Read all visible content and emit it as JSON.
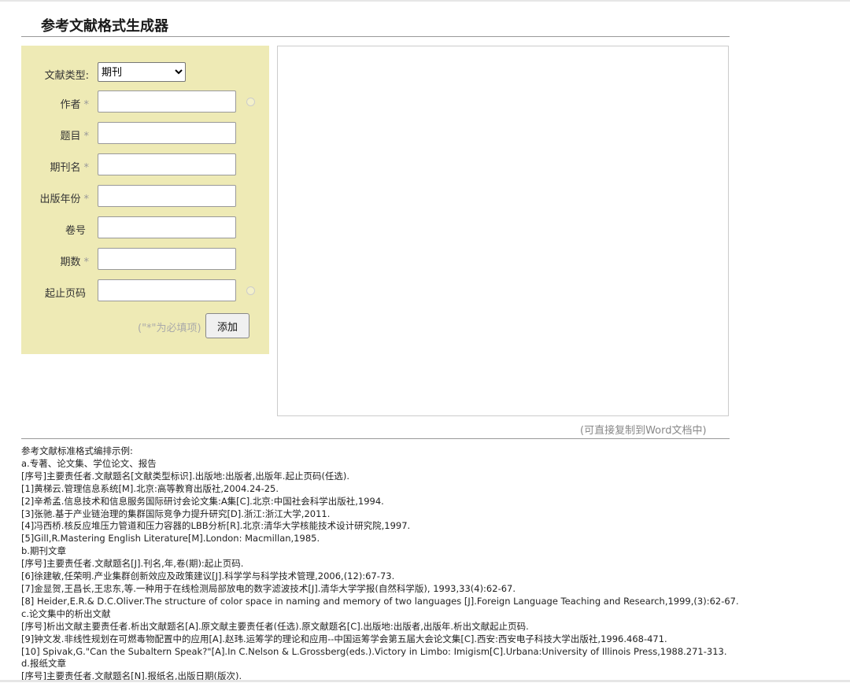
{
  "page": {
    "title": "参考文献格式生成器"
  },
  "form": {
    "doc_type_label": "文献类型:",
    "doc_type_value": "期刊",
    "fields": [
      {
        "label": "作者",
        "required": "*",
        "value": "",
        "optional_dot": true
      },
      {
        "label": "题目",
        "required": "*",
        "value": "",
        "optional_dot": false
      },
      {
        "label": "期刊名",
        "required": "*",
        "value": "",
        "optional_dot": false
      },
      {
        "label": "出版年份",
        "required": "*",
        "value": "",
        "optional_dot": false
      },
      {
        "label": "卷号",
        "required": "",
        "value": "",
        "optional_dot": false
      },
      {
        "label": "期数",
        "required": "*",
        "value": "",
        "optional_dot": false
      },
      {
        "label": "起止页码",
        "required": "",
        "value": "",
        "optional_dot": true
      }
    ],
    "required_hint": "(\"*\"为必填项)",
    "add_button": "添加"
  },
  "output": {
    "content": "",
    "copy_hint": "(可直接复制到Word文档中)"
  },
  "examples": [
    "参考文献标准格式编排示例:",
    "a.专著、论文集、学位论文、报告",
    "[序号]主要责任者.文献题名[文献类型标识].出版地:出版者,出版年.起止页码(任选).",
    "[1]黄梯云.管理信息系统[M].北京:高等教育出版社,2004.24-25.",
    "[2]辛希孟.信息技术和信息服务国际研讨会论文集:A集[C].北京:中国社会科学出版社,1994.",
    "[3]张驰.基于产业链治理的集群国际竞争力提升研究[D].浙江:浙江大学,2011.",
    "[4]冯西桥.核反应堆压力管道和压力容器的LBB分析[R].北京:清华大学核能技术设计研究院,1997.",
    "[5]Gill,R.Mastering English Literature[M].London: Macmillan,1985.",
    "b.期刊文章",
    "[序号]主要责任者.文献题名[J].刊名,年,卷(期):起止页码.",
    "[6]徐建敏,任荣明.产业集群创新效应及政策建议[J].科学学与科学技术管理,2006,(12):67-73.",
    "[7]金显贺,王昌长,王忠东,等.一种用于在线检测局部放电的数字滤波技术[J].清华大学学报(自然科学版), 1993,33(4):62-67.",
    "[8] Heider,E.R.& D.C.Oliver.The structure of color space in naming and memory of two languages [J].Foreign Language Teaching and Research,1999,(3):62-67.",
    "c.论文集中的析出文献",
    "[序号]析出文献主要责任者.析出文献题名[A].原文献主要责任者(任选).原文献题名[C].出版地:出版者,出版年.析出文献起止页码.",
    "[9]钟文发.非线性规划在可燃毒物配置中的应用[A].赵玮.运筹学的理论和应用--中国运筹学会第五届大会论文集[C].西安:西安电子科技大学出版社,1996.468-471.",
    "[10] Spivak,G.\"Can the Subaltern Speak?\"[A].In C.Nelson & L.Grossberg(eds.).Victory in Limbo: Imigism[C].Urbana:University of Illinois Press,1988.271-313.",
    "d.报纸文章",
    "[序号]主要责任者.文献题名[N].报纸名,出版日期(版次)."
  ]
}
